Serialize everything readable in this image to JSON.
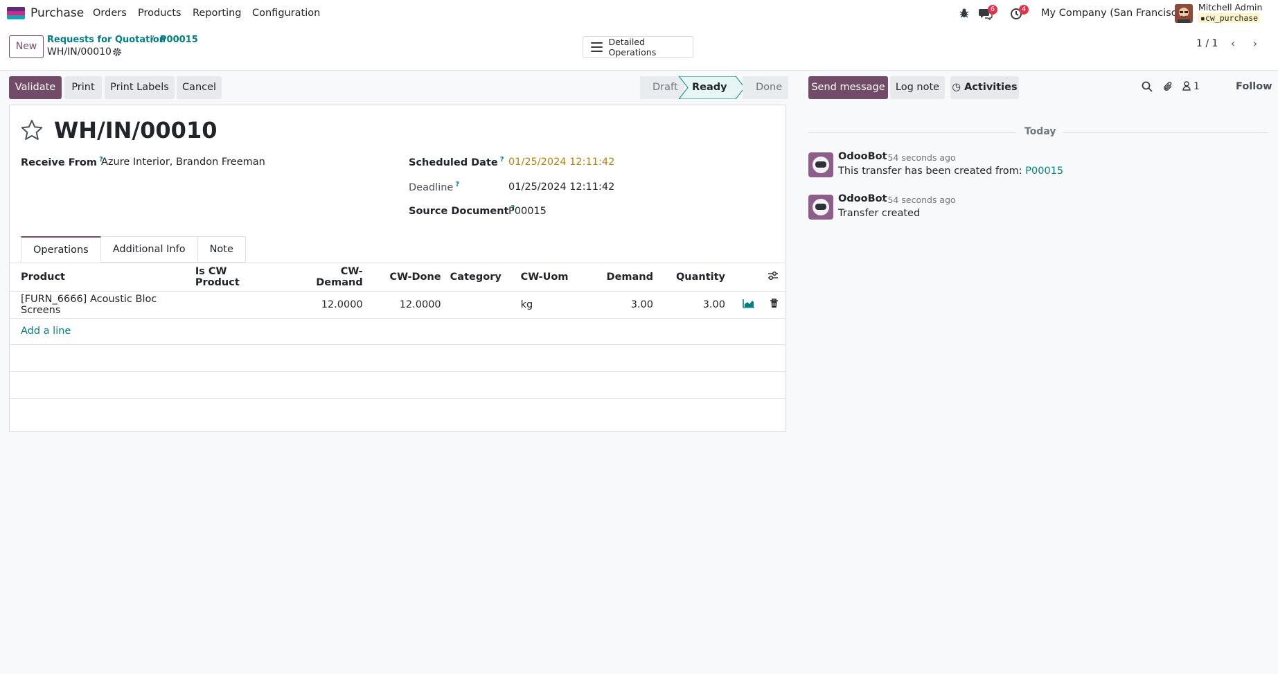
{
  "navbar": {
    "app_name": "Purchase",
    "menu": [
      "Orders",
      "Products",
      "Reporting",
      "Configuration"
    ],
    "messages_count": "6",
    "activities_count": "4",
    "company": "My Company (San Francisco)",
    "user_name": "Mitchell Admin",
    "user_db": "cw_purchase"
  },
  "control_panel": {
    "new_label": "New",
    "breadcrumb": [
      "Requests for Quotation",
      "P00015"
    ],
    "breadcrumb_sep": "/",
    "current": "WH/IN/00010",
    "detailed_ops_label": "Detailed Operations",
    "pager": "1 / 1"
  },
  "actions": {
    "validate": "Validate",
    "print": "Print",
    "print_labels": "Print Labels",
    "cancel": "Cancel"
  },
  "status": {
    "steps": [
      "Draft",
      "Ready",
      "Done"
    ],
    "active": "Ready"
  },
  "form": {
    "name": "WH/IN/00010",
    "receive_from_label": "Receive From",
    "receive_from": "Azure Interior, Brandon Freeman",
    "scheduled_date_label": "Scheduled Date",
    "scheduled_date": "01/25/2024 12:11:42",
    "deadline_label": "Deadline",
    "deadline": "01/25/2024 12:11:42",
    "source_document_label": "Source Document",
    "source_document": "P00015",
    "tooltip_mark": "?"
  },
  "tabs": [
    "Operations",
    "Additional Info",
    "Note"
  ],
  "operations": {
    "columns": [
      "Product",
      "Is CW Product",
      "CW-Demand",
      "CW-Done",
      "Category",
      "CW-Uom",
      "Demand",
      "Quantity"
    ],
    "rows": [
      {
        "product": "[FURN_6666] Acoustic Bloc Screens",
        "is_cw": "",
        "cw_demand": "12.0000",
        "cw_done": "12.0000",
        "category": "",
        "cw_uom": "kg",
        "demand": "3.00",
        "quantity": "3.00"
      }
    ],
    "add_line": "Add a line"
  },
  "chatter": {
    "send_message": "Send message",
    "log_note": "Log note",
    "activities": "Activities",
    "followers_count": "1",
    "follow": "Follow",
    "day": "Today",
    "messages": [
      {
        "author": "OdooBot",
        "time": "- 54 seconds ago",
        "text": "This transfer has been created from:",
        "link": "P00015"
      },
      {
        "author": "OdooBot",
        "time": "- 54 seconds ago",
        "text": "Transfer created",
        "link": ""
      }
    ]
  },
  "colors": {
    "primary": "#714b67",
    "link": "#017e84",
    "warning": "#b5840c",
    "badge": "#e4324a"
  }
}
